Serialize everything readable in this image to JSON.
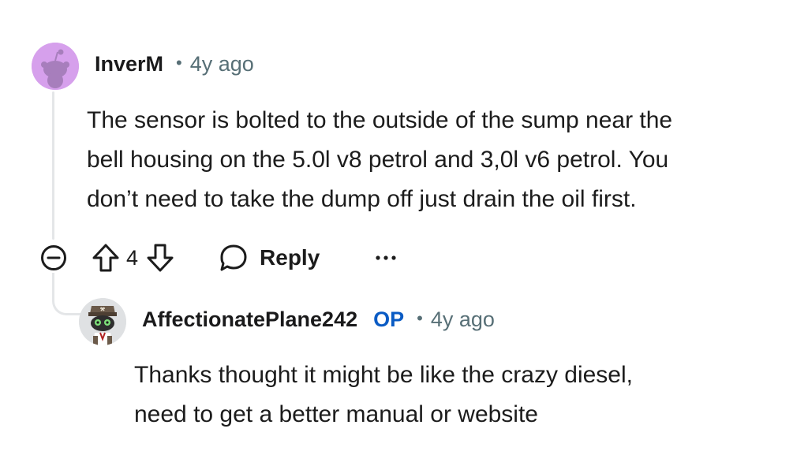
{
  "comments": [
    {
      "username": "InverM",
      "time": "4y ago",
      "body": "The sensor is bolted to the outside of the sump near the\nbell housing on the 5.0l v8 petrol and 3,0l v6 petrol. You\ndon’t need to take the dump off just drain the oil first.",
      "votes": "4",
      "reply_label": "Reply",
      "avatar_color": "#d6a0ec",
      "avatar_icon": "snoo-avatar-icon"
    },
    {
      "username": "AffectionatePlane242",
      "op_badge": "OP",
      "time": "4y ago",
      "body": "Thanks thought it might be like the crazy diesel,\nneed to get a better manual or website",
      "avatar_icon": "snoo-pirate-avatar-icon"
    }
  ],
  "colors": {
    "op_badge": "#0a5bc4",
    "meta_text": "#576f76",
    "thread_line": "#e4e6e8"
  },
  "meta_separator": "•"
}
